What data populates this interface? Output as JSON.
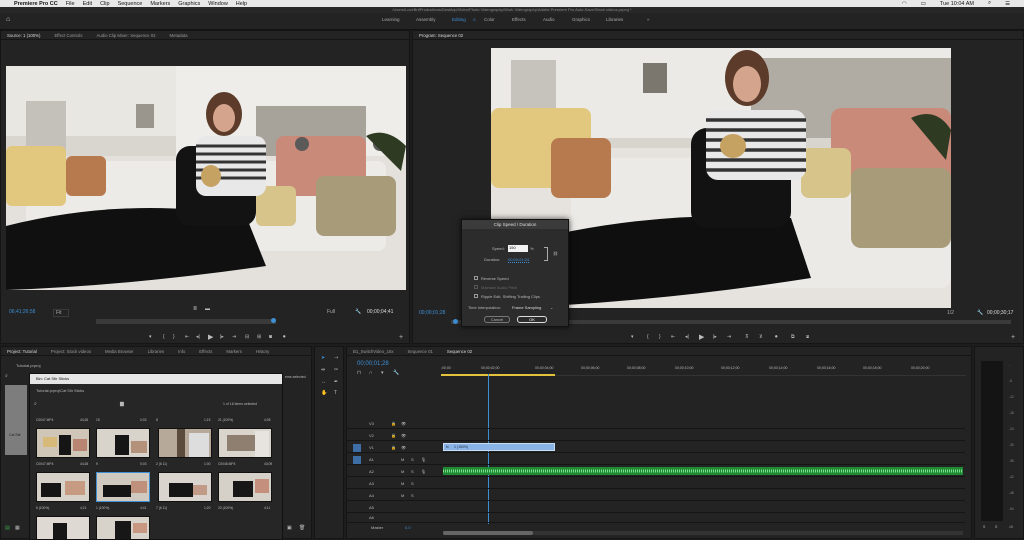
{
  "menu": {
    "apple": "",
    "app": "Premiere Pro CC",
    "items": [
      "File",
      "Edit",
      "Clip",
      "Sequence",
      "Markers",
      "Graphics",
      "Window",
      "Help"
    ],
    "clock": "Tue 10:04 AM"
  },
  "window_path": "/Users/LoveBritProductions/Desktop/Video/Photo Videography/Work Videography/Adobe Premiere Pro Auto-Save/Stock videos.prproj *",
  "workspaces": {
    "home_icon": "home-icon",
    "items": [
      "Learning",
      "Assembly",
      "Editing",
      "Color",
      "Effects",
      "Audio",
      "Graphics",
      "Libraries"
    ],
    "active": "Editing",
    "more": "»"
  },
  "source_panel": {
    "tabs": [
      "Source: 1 (100%)",
      "Effect Controls",
      "Audio Clip Mixer: Sequence 02",
      "Metadata"
    ],
    "timecode_in": "06;41;26;58",
    "zoom": "Fit",
    "page": "1/2",
    "timecode_dur": "00;00;04;41",
    "quality": "Full"
  },
  "program_panel": {
    "tabs": [
      "Program: Sequence 02"
    ],
    "timecode_in": "00;00;01;28",
    "timecode_dur": "00;00;30;17",
    "quality": "1/2",
    "zoom": "Fit"
  },
  "dialog": {
    "title": "Clip Speed / Duration",
    "speed_label": "Speed:",
    "speed_value": "150",
    "speed_unit": "%",
    "duration_label": "Duration:",
    "duration_value": "00;00;01;24",
    "reverse": "Reverse Speed",
    "maintain": "Maintain Audio Pitch",
    "ripple": "Ripple Edit, Shifting Trailing Clips",
    "interp_label": "Time Interpolation:",
    "interp_value": "Frame Sampling",
    "cancel": "Cancel",
    "ok": "OK"
  },
  "project_panel": {
    "tabs": [
      "Project: Tutorial",
      "Project: Stock videos",
      "Media Browser",
      "Libraries",
      "Info",
      "Effects",
      "Markers",
      "History"
    ],
    "project_file": "Tutorial.prproj",
    "bin_title": "Bin: Cat Stir Sticks",
    "bin_path": "Tutorial.prproj\\Cat Stir Sticks",
    "item_count": "1 of 16 items selected",
    "selected_side": "ems selected",
    "side_bin": "Cat Stir",
    "clips": [
      {
        "name": "C0047.MP4",
        "dur": "44;26"
      },
      {
        "name": "15",
        "dur": "0;03"
      },
      {
        "name": "8",
        "dur": "1;15"
      },
      {
        "name": "21 (100%)",
        "dur": "4;05"
      },
      {
        "name": "C0047.MP4",
        "dur": "44;26"
      },
      {
        "name": "9",
        "dur": "0;03"
      },
      {
        "name": "2 (6 11)",
        "dur": "1;00"
      },
      {
        "name": "C0048.MP4",
        "dur": "43;09"
      },
      {
        "name": "6 (100%)",
        "dur": "4;21"
      },
      {
        "name": "1 (100%)",
        "dur": "4;41"
      },
      {
        "name": "7 (6 11)",
        "dur": "1;20"
      },
      {
        "name": "20 (100%)",
        "dur": "4;11"
      }
    ]
  },
  "timeline": {
    "tabs": [
      "B1_SwitchVideo_16x",
      "Sequence 01",
      "Sequence 02"
    ],
    "active": "Sequence 02",
    "timecode": "00;00;01;28",
    "ruler": [
      ";00;00",
      "00;00;02;00",
      "00;00;04;00",
      "00;00;06;00",
      "00;00;08;00",
      "00;00;10;00",
      "00;00;12;00",
      "00;00;14;00",
      "00;00;16;00",
      "00;00;18;00",
      "00;00;20;00"
    ],
    "video_tracks": [
      "V3",
      "V2",
      "V1"
    ],
    "audio_tracks": [
      "A1",
      "A2",
      "A3",
      "A4",
      "A5",
      "A6"
    ],
    "master": "Master",
    "master_val": "0.0",
    "clip_label": "1 (150%)"
  },
  "meter": {
    "ticks": [
      "-",
      "-6",
      "-12",
      "-18",
      "-24",
      "-30",
      "-36",
      "-42",
      "-48",
      "-54",
      "dB"
    ],
    "solo": "S",
    "solo2": "S"
  },
  "colors": {
    "accent": "#3d8fd6",
    "clip_blue": "#8ab3e6",
    "audio_green": "#1f8a33"
  }
}
